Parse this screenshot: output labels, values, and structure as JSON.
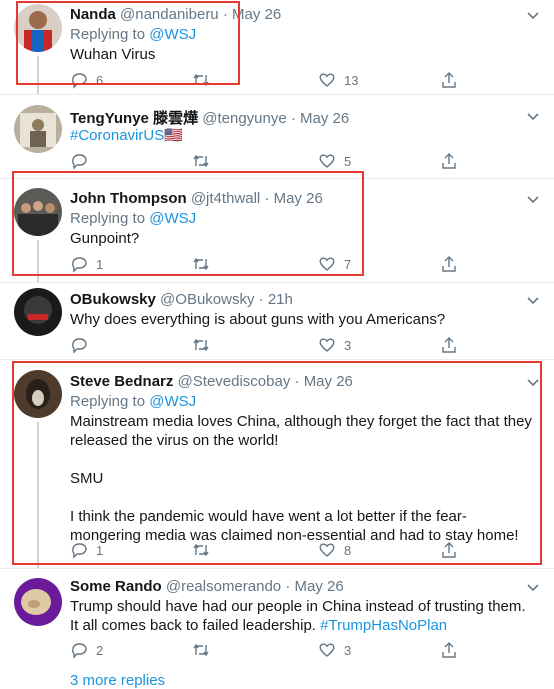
{
  "tweets": [
    {
      "name": "Nanda",
      "handle": "@nandaniberu",
      "dot": "·",
      "date": "May 26",
      "replying_prefix": "Replying to ",
      "replying_to": "@WSJ",
      "text": "Wuhan Virus",
      "reply_count": "6",
      "retweet_count": "",
      "like_count": "13"
    },
    {
      "name": "TengYunye 滕雲燁",
      "handle": "@tengyunye",
      "dot": "·",
      "date": "May 26",
      "text_link": "#CoronavirUS",
      "flag": "🇺🇸",
      "reply_count": "",
      "retweet_count": "",
      "like_count": "5"
    },
    {
      "name": "John Thompson",
      "handle": "@jt4thwall",
      "dot": "·",
      "date": "May 26",
      "replying_prefix": "Replying to ",
      "replying_to": "@WSJ",
      "text": "Gunpoint?",
      "reply_count": "1",
      "retweet_count": "",
      "like_count": "7"
    },
    {
      "name": "OBukowsky",
      "handle": "@OBukowsky",
      "dot": "·",
      "date": "21h",
      "text": "Why does everything is about guns with you Americans?",
      "reply_count": "",
      "retweet_count": "",
      "like_count": "3"
    },
    {
      "name": "Steve Bednarz",
      "handle": "@Stevediscobay",
      "dot": "·",
      "date": "May 26",
      "replying_prefix": "Replying to ",
      "replying_to": "@WSJ",
      "para1_line1": "Mainstream media loves China, although they forget the fact that they",
      "para1_line2": "released the virus on the world!",
      "para2": "SMU",
      "para3_line1": "I think the pandemic would have went a lot better if the fear-",
      "para3_line2": "mongering media was claimed non-essential and had to stay home!",
      "reply_count": "1",
      "retweet_count": "",
      "like_count": "8"
    },
    {
      "name": "Some Rando",
      "handle": "@realsomerando",
      "dot": "·",
      "date": "May 26",
      "line1": "Trump should have had our people in China instead of trusting them.",
      "line2_text": "It all comes back to failed leadership. ",
      "line2_link": "#TrumpHasNoPlan",
      "reply_count": "2",
      "retweet_count": "",
      "like_count": "3"
    }
  ],
  "more_replies": "3 more replies",
  "colors": {
    "highlight": "#e53935",
    "link": "#1b95e0",
    "muted": "#657786"
  }
}
